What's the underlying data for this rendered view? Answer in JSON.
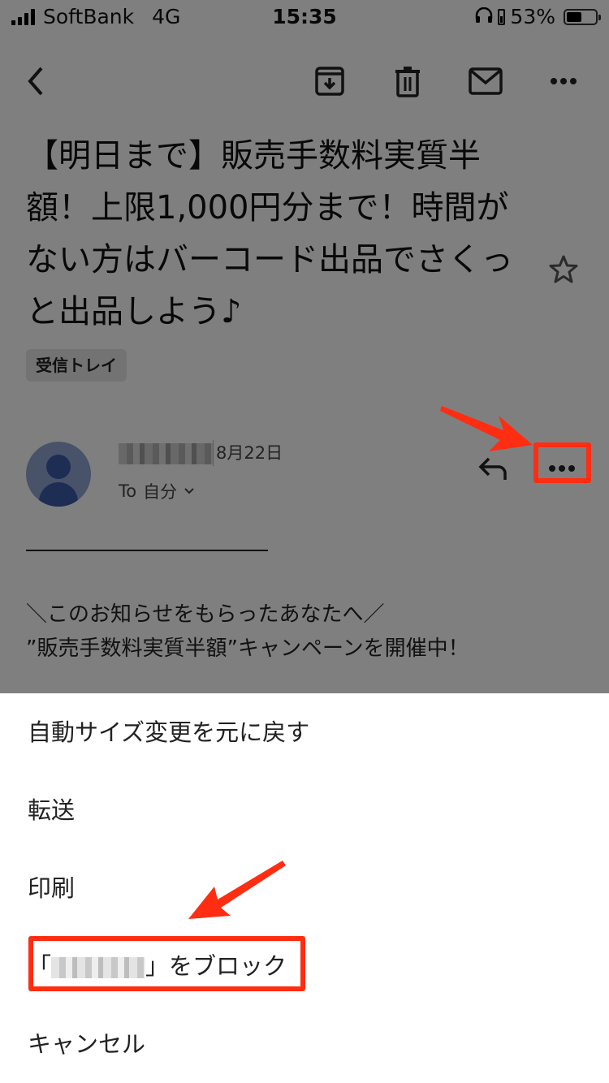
{
  "status_bar": {
    "carrier": "SoftBank",
    "network": "4G",
    "time": "15:35",
    "battery_percent": "53%",
    "battery_level": 0.53,
    "icons": [
      "signal-icon",
      "headphones-icon",
      "battery-charging-icon",
      "battery-icon"
    ]
  },
  "toolbar": {
    "buttons": [
      {
        "name": "back",
        "icon": "chevron-left-icon"
      },
      {
        "name": "archive",
        "icon": "archive-icon"
      },
      {
        "name": "delete",
        "icon": "trash-icon"
      },
      {
        "name": "mark-unread",
        "icon": "mail-icon"
      },
      {
        "name": "more",
        "icon": "more-horizontal-icon"
      }
    ]
  },
  "email": {
    "subject": "【明日まで】販売手数料実質半額！上限1,000円分まで！時間がない方はバーコード出品でさくっと出品しよう♪",
    "label": "受信トレイ",
    "starred": false,
    "sender": {
      "name_redacted": true,
      "date": "8月22日",
      "to_prefix": "To",
      "to": "自分"
    },
    "body": {
      "line1": "＼このお知らせをもらったあなたへ／",
      "line2": "”販売手数料実質半額”キャンペーンを開催中！"
    }
  },
  "action_sheet": {
    "items": [
      {
        "label": "自動サイズ変更を元に戻す"
      },
      {
        "label": "転送"
      },
      {
        "label": "印刷"
      },
      {
        "label_prefix": "「",
        "label_suffix": "」をブロック",
        "name_redacted": true
      },
      {
        "label": "キャンセル"
      }
    ]
  },
  "annotations": {
    "color": "#ff2d12",
    "highlighted": [
      "message-more-button",
      "block-sender-item"
    ]
  }
}
